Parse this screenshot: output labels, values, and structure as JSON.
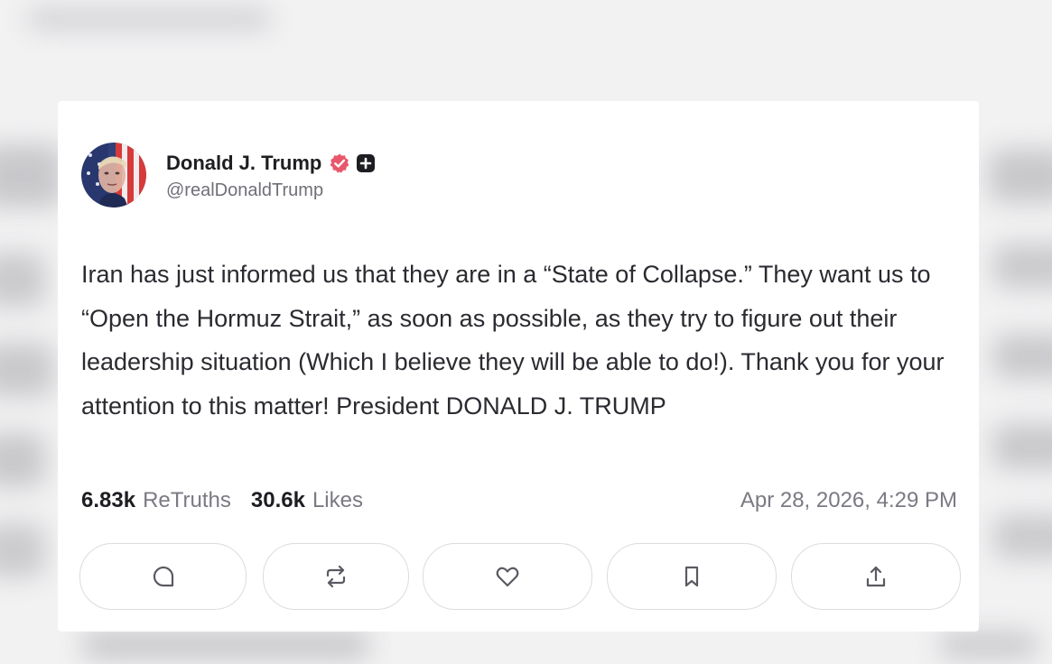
{
  "author": {
    "display_name": "Donald J. Trump",
    "handle": "@realDonaldTrump",
    "avatar_icon": "avatar-portrait",
    "verified_icon": "verified-badge-icon",
    "plus_icon": "plus-badge-icon"
  },
  "post": {
    "text": "Iran has just informed us that they are in a “State of Collapse.” They want us to “Open the Hormuz Strait,” as soon as possible, as they try to figure out their leadership situation (Which I believe they will be able to do!). Thank you for your attention to this matter! President DONALD J. TRUMP"
  },
  "stats": {
    "retruths_count": "6.83k",
    "retruths_label": "ReTruths",
    "likes_count": "30.6k",
    "likes_label": "Likes",
    "timestamp": "Apr 28, 2026, 4:29 PM"
  },
  "actions": [
    {
      "name": "reply",
      "icon": "comment-icon"
    },
    {
      "name": "retruth",
      "icon": "repost-icon"
    },
    {
      "name": "like",
      "icon": "heart-icon"
    },
    {
      "name": "bookmark",
      "icon": "bookmark-icon"
    },
    {
      "name": "share",
      "icon": "share-icon"
    }
  ],
  "colors": {
    "verified_badge": "#e9576b",
    "plus_badge": "#1d1d22",
    "text_primary": "#2a2a30",
    "text_secondary": "#7a7a83",
    "icon": "#5a5a62"
  }
}
